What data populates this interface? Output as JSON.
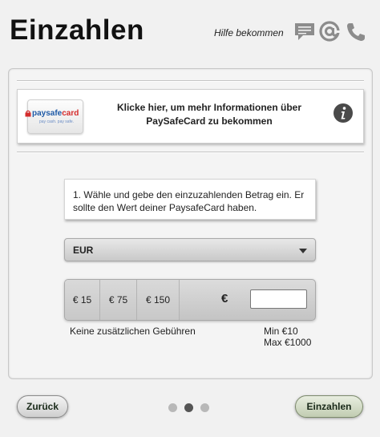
{
  "header": {
    "title": "Einzahlen",
    "help_label": "Hilfe bekommen",
    "icons": [
      "chat-icon",
      "at-icon",
      "phone-icon"
    ]
  },
  "info": {
    "logo_brand_a": "paysafe",
    "logo_brand_b": "card",
    "logo_slogan": "pay cash. pay safe.",
    "text_line1": "Klicke hier, um mehr Informationen über",
    "text_line2": "PaySafeCard zu bekommen",
    "icon": "info-icon"
  },
  "step": {
    "line1": "1. Wähle und gebe den einzuzahlenden Betrag ein. Er",
    "line2": "sollte den Wert deiner PaysafeCard haben."
  },
  "currency": {
    "selected": "EUR"
  },
  "amounts": {
    "presets": [
      "€ 15",
      "€ 75",
      "€ 150"
    ],
    "currency_symbol": "€",
    "input_value": ""
  },
  "fees": {
    "text": "Keine zusätzlichen Gebühren",
    "min": "Min €10",
    "max": "Max €1000"
  },
  "footer": {
    "back_label": "Zurück",
    "deposit_label": "Einzahlen",
    "steps_total": 3,
    "active_step": 2
  },
  "colors": {
    "background": "#f1f1f1",
    "accent_button": "#c1ccb1"
  }
}
